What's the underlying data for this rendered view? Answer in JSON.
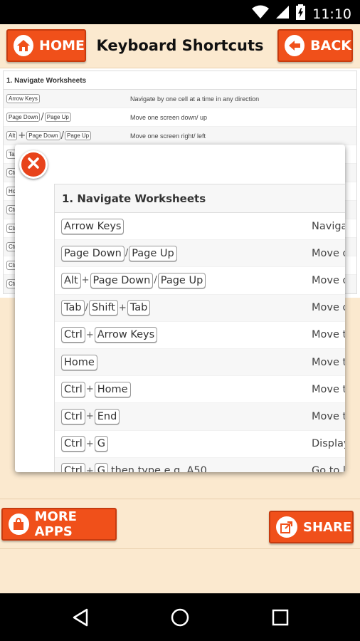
{
  "status_bar": {
    "time": "11:10",
    "icons": [
      "wifi-icon",
      "signal-icon",
      "battery-icon"
    ]
  },
  "header": {
    "home_label": "HOME",
    "title": "Keyboard Shortcuts",
    "back_label": "BACK"
  },
  "background_table": {
    "title": "1. Navigate Worksheets",
    "rows": [
      {
        "keys": [
          "Arrow Keys"
        ],
        "desc": "Navigate by one cell at a time in any direction"
      },
      {
        "keys": [
          "Page Down",
          "/",
          "Page Up"
        ],
        "desc": "Move one screen down/ up"
      },
      {
        "keys": [
          "Alt",
          "+",
          "Page Down",
          "/",
          "Page Up"
        ],
        "desc": "Move one screen right/ left"
      },
      {
        "keys": [
          "Tab"
        ],
        "desc": ""
      },
      {
        "keys": [
          "Ctrl"
        ],
        "desc": ""
      },
      {
        "keys": [
          "Hom"
        ],
        "desc": ""
      },
      {
        "keys": [
          "Ctrl"
        ],
        "desc": ""
      },
      {
        "keys": [
          "Ctrl"
        ],
        "desc": ""
      },
      {
        "keys": [
          "Ctrl"
        ],
        "desc": ""
      },
      {
        "keys": [
          "Ctrl"
        ],
        "desc": ""
      },
      {
        "keys": [
          "Ctrl"
        ],
        "desc": ""
      }
    ]
  },
  "popup": {
    "title": "1. Navigate Worksheets",
    "rows": [
      {
        "keys": [
          "Arrow Keys"
        ],
        "desc": "Naviga"
      },
      {
        "keys": [
          "Page Down",
          "/",
          "Page Up"
        ],
        "desc": "Move o"
      },
      {
        "keys": [
          "Alt",
          "+",
          "Page Down",
          "/",
          "Page Up"
        ],
        "desc": "Move o"
      },
      {
        "keys": [
          "Tab",
          "/",
          "Shift",
          "+",
          "Tab"
        ],
        "desc": "Move o"
      },
      {
        "keys": [
          "Ctrl",
          "+",
          "Arrow Keys"
        ],
        "desc": "Move t"
      },
      {
        "keys": [
          "Home"
        ],
        "desc": "Move t"
      },
      {
        "keys": [
          "Ctrl",
          "+",
          "Home"
        ],
        "desc": "Move t"
      },
      {
        "keys": [
          "Ctrl",
          "+",
          "End"
        ],
        "desc": "Move t"
      },
      {
        "keys": [
          "Ctrl",
          "+",
          "G"
        ],
        "desc": "Display"
      },
      {
        "keys": [
          "Ctrl",
          "+",
          "G"
        ],
        "after": "then type e.g. A50",
        "desc": "Go to l"
      }
    ]
  },
  "footer": {
    "more_apps_label": "MORE APPS",
    "share_label": "SHARE"
  },
  "colors": {
    "accent": "#f0501a",
    "background": "#fbe9cf",
    "close": "#e8431b"
  }
}
